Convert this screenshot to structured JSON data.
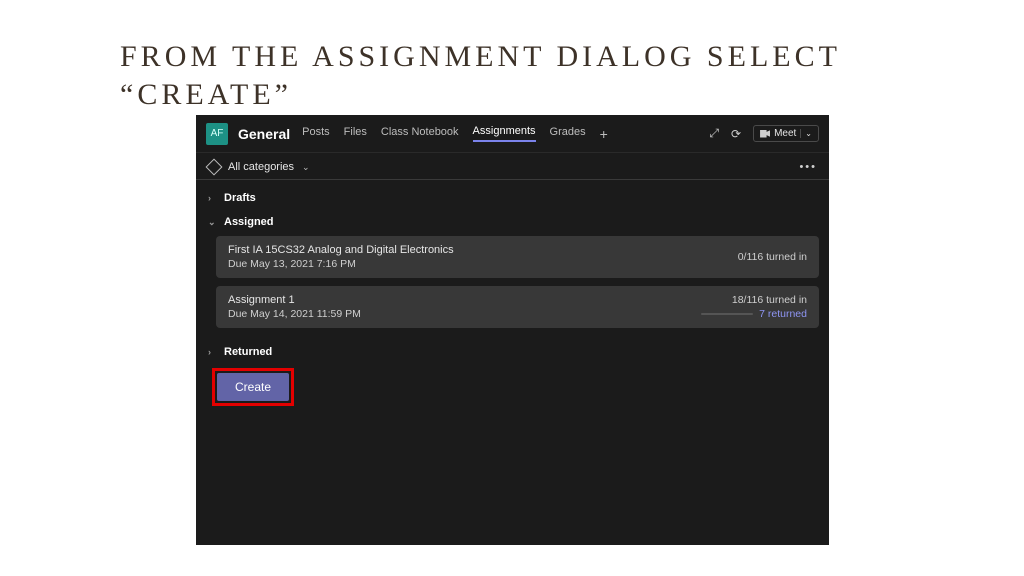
{
  "slide": {
    "title": "FROM THE ASSIGNMENT DIALOG SELECT “CREATE”"
  },
  "header": {
    "team_initials": "AF",
    "channel": "General",
    "tabs": {
      "posts": "Posts",
      "files": "Files",
      "notebook": "Class Notebook",
      "assignments": "Assignments",
      "grades": "Grades"
    },
    "meet_label": "Meet"
  },
  "filters": {
    "all_categories": "All categories"
  },
  "sections": {
    "drafts": "Drafts",
    "assigned": "Assigned",
    "returned": "Returned"
  },
  "assignments": [
    {
      "title": "First IA 15CS32 Analog and Digital Electronics",
      "due": "Due May 13, 2021 7:16 PM",
      "turned_in": "0/116 turned in",
      "returned": ""
    },
    {
      "title": "Assignment 1",
      "due": "Due May 14, 2021 11:59 PM",
      "turned_in": "18/116 turned in",
      "returned": "7 returned"
    }
  ],
  "buttons": {
    "create": "Create"
  }
}
